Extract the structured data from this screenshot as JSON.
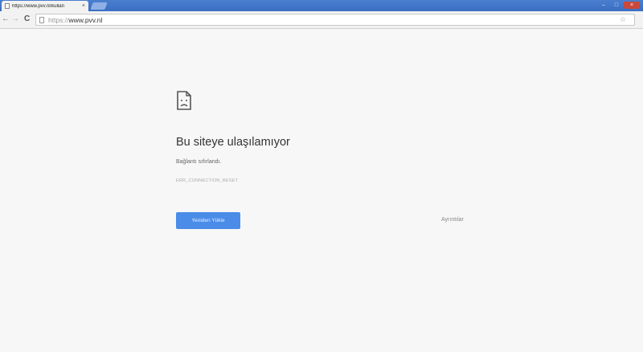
{
  "browser": {
    "tab": {
      "title": "https://www.pvv.nl/kullan",
      "close_glyph": "×"
    },
    "window_controls": {
      "minimize": "–",
      "maximize": "□",
      "close": "×"
    },
    "nav": {
      "back": "←",
      "forward": "→",
      "reload": "C"
    },
    "address_bar": {
      "scheme": "https://",
      "host": "www.pvv.nl"
    },
    "bookmark_glyph": "☆"
  },
  "error_page": {
    "icon": "sad-page-icon",
    "heading": "Bu siteye ulaşılamıyor",
    "message": "Bağlantı sıfırlandı.",
    "error_code": "ERR_CONNECTION_RESET",
    "reload_label": "Yeniden Yükle",
    "details_label": "Ayrıntılar",
    "accent_color": "#4a8ce8"
  }
}
